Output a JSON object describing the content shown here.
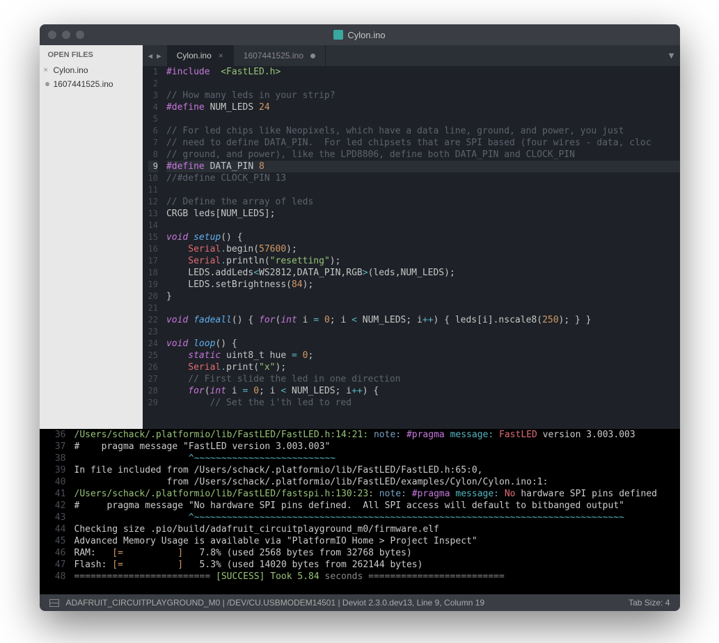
{
  "window": {
    "title": "Cylon.ino"
  },
  "sidebar": {
    "header": "OPEN FILES",
    "items": [
      {
        "name": "Cylon.ino",
        "dirty": false,
        "closable": true
      },
      {
        "name": "1607441525.ino",
        "dirty": true,
        "closable": false
      }
    ]
  },
  "tabs": [
    {
      "label": "Cylon.ino",
      "active": true,
      "dirty": false
    },
    {
      "label": "1607441525.ino",
      "active": false,
      "dirty": true
    }
  ],
  "editor": {
    "active_line": 9,
    "lines": [
      {
        "n": 1,
        "seg": [
          [
            "preproc",
            "#include"
          ],
          [
            "",
            "  "
          ],
          [
            "string",
            "<FastLED.h>"
          ]
        ]
      },
      {
        "n": 2,
        "seg": []
      },
      {
        "n": 3,
        "seg": [
          [
            "comment",
            "// How many leds in your strip?"
          ]
        ]
      },
      {
        "n": 4,
        "seg": [
          [
            "preproc",
            "#define"
          ],
          [
            "",
            " "
          ],
          [
            "",
            "NUM_LEDS "
          ],
          [
            "number",
            "24"
          ]
        ]
      },
      {
        "n": 5,
        "seg": []
      },
      {
        "n": 6,
        "seg": [
          [
            "comment",
            "// For led chips like Neopixels, which have a data line, ground, and power, you just"
          ]
        ]
      },
      {
        "n": 7,
        "seg": [
          [
            "comment",
            "// need to define DATA_PIN.  For led chipsets that are SPI based (four wires - data, cloc"
          ]
        ]
      },
      {
        "n": 8,
        "seg": [
          [
            "comment",
            "// ground, and power), like the LPD8806, define both DATA_PIN and CLOCK_PIN"
          ]
        ]
      },
      {
        "n": 9,
        "seg": [
          [
            "preproc",
            "#define"
          ],
          [
            "",
            " "
          ],
          [
            "",
            "DATA_PIN "
          ],
          [
            "number",
            "8"
          ]
        ]
      },
      {
        "n": 10,
        "seg": [
          [
            "comment",
            "//#define CLOCK_PIN 13"
          ]
        ]
      },
      {
        "n": 11,
        "seg": []
      },
      {
        "n": 12,
        "seg": [
          [
            "comment",
            "// Define the array of leds"
          ]
        ]
      },
      {
        "n": 13,
        "seg": [
          [
            "",
            "CRGB leds[NUM_LEDS];"
          ]
        ]
      },
      {
        "n": 14,
        "seg": []
      },
      {
        "n": 15,
        "seg": [
          [
            "type",
            "void"
          ],
          [
            "",
            " "
          ],
          [
            "func",
            "setup"
          ],
          [
            "",
            "() {"
          ]
        ]
      },
      {
        "n": 16,
        "seg": [
          [
            "",
            "    "
          ],
          [
            "ident",
            "Serial"
          ],
          [
            "op",
            "."
          ],
          [
            "",
            "begin("
          ],
          [
            "number",
            "57600"
          ],
          [
            "",
            ");"
          ]
        ]
      },
      {
        "n": 17,
        "seg": [
          [
            "",
            "    "
          ],
          [
            "ident",
            "Serial"
          ],
          [
            "op",
            "."
          ],
          [
            "",
            "println("
          ],
          [
            "string",
            "\"resetting\""
          ],
          [
            "",
            ");"
          ]
        ]
      },
      {
        "n": 18,
        "seg": [
          [
            "",
            "    LEDS.addLeds"
          ],
          [
            "op",
            "<"
          ],
          [
            "",
            "WS2812,DATA_PIN,RGB"
          ],
          [
            "op",
            ">"
          ],
          [
            "",
            "(leds,NUM_LEDS);"
          ]
        ]
      },
      {
        "n": 19,
        "seg": [
          [
            "",
            "    LEDS.setBrightness("
          ],
          [
            "number",
            "84"
          ],
          [
            "",
            ");"
          ]
        ]
      },
      {
        "n": 20,
        "seg": [
          [
            "",
            "}"
          ]
        ]
      },
      {
        "n": 21,
        "seg": []
      },
      {
        "n": 22,
        "seg": [
          [
            "type",
            "void"
          ],
          [
            "",
            " "
          ],
          [
            "func",
            "fadeall"
          ],
          [
            "",
            "() { "
          ],
          [
            "keyword",
            "for"
          ],
          [
            "",
            "("
          ],
          [
            "type",
            "int"
          ],
          [
            "",
            " i "
          ],
          [
            "op",
            "="
          ],
          [
            "",
            " "
          ],
          [
            "number",
            "0"
          ],
          [
            "",
            "; i "
          ],
          [
            "op",
            "<"
          ],
          [
            "",
            " NUM_LEDS; i"
          ],
          [
            "op",
            "++"
          ],
          [
            "",
            ") { leds[i].nscale8("
          ],
          [
            "number",
            "250"
          ],
          [
            "",
            "); } }"
          ]
        ]
      },
      {
        "n": 23,
        "seg": []
      },
      {
        "n": 24,
        "seg": [
          [
            "type",
            "void"
          ],
          [
            "",
            " "
          ],
          [
            "func",
            "loop"
          ],
          [
            "",
            "() {"
          ]
        ]
      },
      {
        "n": 25,
        "seg": [
          [
            "",
            "    "
          ],
          [
            "keyword",
            "static"
          ],
          [
            "",
            " uint8_t hue "
          ],
          [
            "op",
            "="
          ],
          [
            "",
            " "
          ],
          [
            "number",
            "0"
          ],
          [
            "",
            ";"
          ]
        ]
      },
      {
        "n": 26,
        "seg": [
          [
            "",
            "    "
          ],
          [
            "ident",
            "Serial"
          ],
          [
            "op",
            "."
          ],
          [
            "",
            "print("
          ],
          [
            "string",
            "\"x\""
          ],
          [
            "",
            ");"
          ]
        ]
      },
      {
        "n": 27,
        "seg": [
          [
            "",
            "    "
          ],
          [
            "comment",
            "// First slide the led in one direction"
          ]
        ]
      },
      {
        "n": 28,
        "seg": [
          [
            "",
            "    "
          ],
          [
            "keyword",
            "for"
          ],
          [
            "",
            "("
          ],
          [
            "type",
            "int"
          ],
          [
            "",
            " i "
          ],
          [
            "op",
            "="
          ],
          [
            "",
            " "
          ],
          [
            "number",
            "0"
          ],
          [
            "",
            "; i "
          ],
          [
            "op",
            "<"
          ],
          [
            "",
            " NUM_LEDS; i"
          ],
          [
            "op",
            "++"
          ],
          [
            "",
            ") {"
          ]
        ]
      },
      {
        "n": 29,
        "seg": [
          [
            "",
            "        "
          ],
          [
            "comment",
            "// Set the i'th led to red"
          ]
        ]
      }
    ]
  },
  "console": {
    "rows": [
      {
        "n": 36,
        "seg": [
          [
            "path",
            "/Users/schack/.platformio/lib/FastLED/FastLED.h:14:21:"
          ],
          [
            "",
            " "
          ],
          [
            "note",
            "note:"
          ],
          [
            "",
            " "
          ],
          [
            "pragma",
            "#pragma"
          ],
          [
            "",
            " "
          ],
          [
            "msg",
            "message:"
          ],
          [
            "",
            " "
          ],
          [
            "fast",
            "FastLED"
          ],
          [
            "",
            " version 3.003.003"
          ]
        ]
      },
      {
        "n": 37,
        "seg": [
          [
            "",
            "#    pragma message \"FastLED version 3.003.003\""
          ]
        ]
      },
      {
        "n": 38,
        "seg": [
          [
            "",
            "                     "
          ],
          [
            "caret",
            "^~~~~~~~~~~~~~~~~~~~~~~~~~~"
          ]
        ]
      },
      {
        "n": 39,
        "seg": [
          [
            "",
            "In file included from /Users/schack/.platformio/lib/FastLED/FastLED.h:65:0,"
          ]
        ]
      },
      {
        "n": 40,
        "seg": [
          [
            "",
            "                 from /Users/schack/.platformio/lib/FastLED/examples/Cylon/Cylon.ino:1:"
          ]
        ]
      },
      {
        "n": 41,
        "seg": [
          [
            "path",
            "/Users/schack/.platformio/lib/FastLED/fastspi.h:130:23:"
          ],
          [
            "",
            " "
          ],
          [
            "note",
            "note:"
          ],
          [
            "",
            " "
          ],
          [
            "pragma",
            "#pragma"
          ],
          [
            "",
            " "
          ],
          [
            "msg",
            "message:"
          ],
          [
            "",
            " "
          ],
          [
            "no",
            "No"
          ],
          [
            "",
            " hardware SPI pins defined"
          ]
        ]
      },
      {
        "n": 42,
        "seg": [
          [
            "",
            "#     pragma message \"No hardware SPI pins defined.  All SPI access will default to bitbanged output\""
          ]
        ]
      },
      {
        "n": 43,
        "seg": [
          [
            "",
            "                     "
          ],
          [
            "caret",
            "^~~~~~~~~~~~~~~~~~~~~~~~~~~~~~~~~~~~~~~~~~~~~~~~~~~~~~~~~~~~~~~~~~~~~~~~~~~~~~~~"
          ]
        ]
      },
      {
        "n": 44,
        "seg": [
          [
            "",
            "Checking size .pio/build/adafruit_circuitplayground_m0/firmware.elf"
          ]
        ]
      },
      {
        "n": 45,
        "seg": [
          [
            "",
            "Advanced Memory Usage is available via \"PlatformIO Home > Project Inspect\""
          ]
        ]
      },
      {
        "n": 46,
        "seg": [
          [
            "",
            "RAM:   "
          ],
          [
            "bracket",
            "[="
          ],
          [
            "",
            "          "
          ],
          [
            "bracket",
            "]"
          ],
          [
            "",
            "   7.8% (used 2568 bytes from 32768 bytes)"
          ]
        ]
      },
      {
        "n": 47,
        "seg": [
          [
            "",
            "Flash: "
          ],
          [
            "bracket",
            "[="
          ],
          [
            "",
            "          "
          ],
          [
            "bracket",
            "]"
          ],
          [
            "",
            "   5.3% (used 14020 bytes from 262144 bytes)"
          ]
        ]
      },
      {
        "n": 48,
        "seg": [
          [
            "dim",
            "========================= "
          ],
          [
            "success",
            "[SUCCESS] Took 5.84"
          ],
          [
            "dim",
            " seconds ========================="
          ]
        ]
      }
    ]
  },
  "statusbar": {
    "left": "ADAFRUIT_CIRCUITPLAYGROUND_M0 | /DEV/CU.USBMODEM14501 | Deviot 2.3.0.dev13, Line 9, Column 19",
    "right": "Tab Size: 4"
  }
}
